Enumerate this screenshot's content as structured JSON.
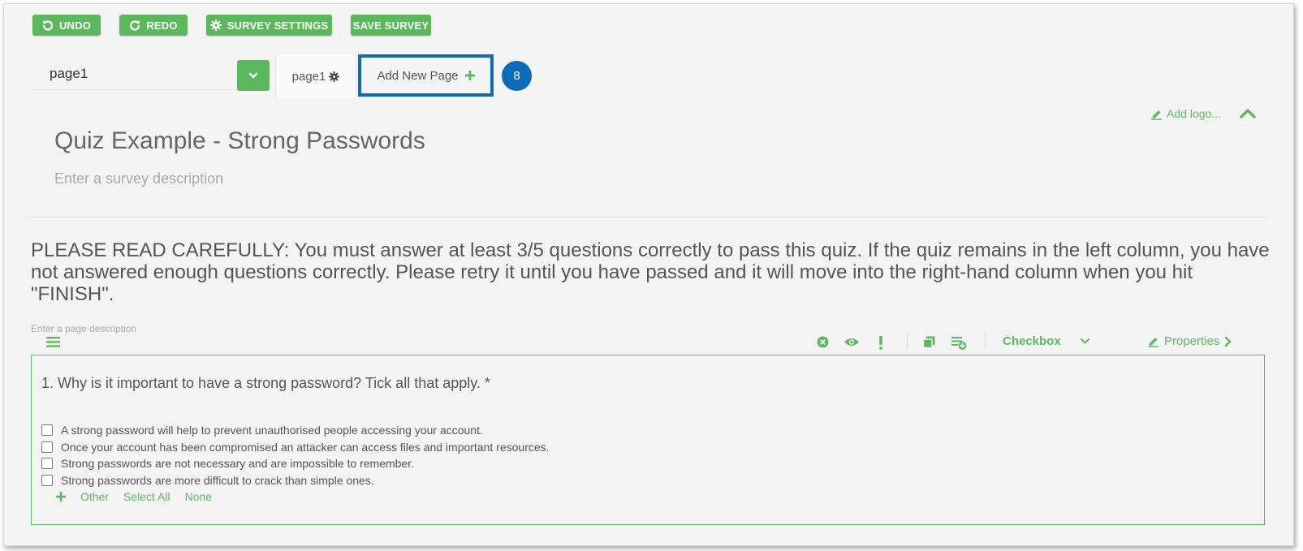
{
  "toolbar": {
    "undo_label": "UNDO",
    "redo_label": "REDO",
    "settings_label": "SURVEY SETTINGS",
    "save_label": "SAVE SURVEY"
  },
  "pages": {
    "selected": "page1",
    "tab_label": "page1",
    "add_new_label": "Add New Page",
    "callout_number": "8"
  },
  "header": {
    "add_logo_label": "Add logo...",
    "title": "Quiz Example - Strong Passwords",
    "description_placeholder": "Enter a survey description"
  },
  "page": {
    "title": "PLEASE READ CAREFULLY: You must answer at least 3/5 questions correctly to pass this quiz. If the quiz remains in the left column, you have not answered enough questions correctly. Please retry it until you have passed and it will move into the right-hand column when you hit \"FINISH\".",
    "description_placeholder": "Enter a page description"
  },
  "question_toolbar": {
    "type_label": "Checkbox",
    "properties_label": "Properties"
  },
  "question": {
    "title": "1. Why is it important to have a strong password? Tick all that apply. *",
    "choices": [
      "A strong password will help to prevent unauthorised people accessing your account.",
      "Once your account has been compromised an attacker can access files and important resources.",
      "Strong passwords are not necessary and are impossible to remember.",
      "Strong passwords are more difficult to crack than simple ones."
    ],
    "footer": {
      "other_label": "Other",
      "select_all_label": "Select All",
      "none_label": "None"
    }
  },
  "colors": {
    "accent": "#5cb85c",
    "highlight": "#0c6cb8",
    "background": "#f4f4f4"
  }
}
